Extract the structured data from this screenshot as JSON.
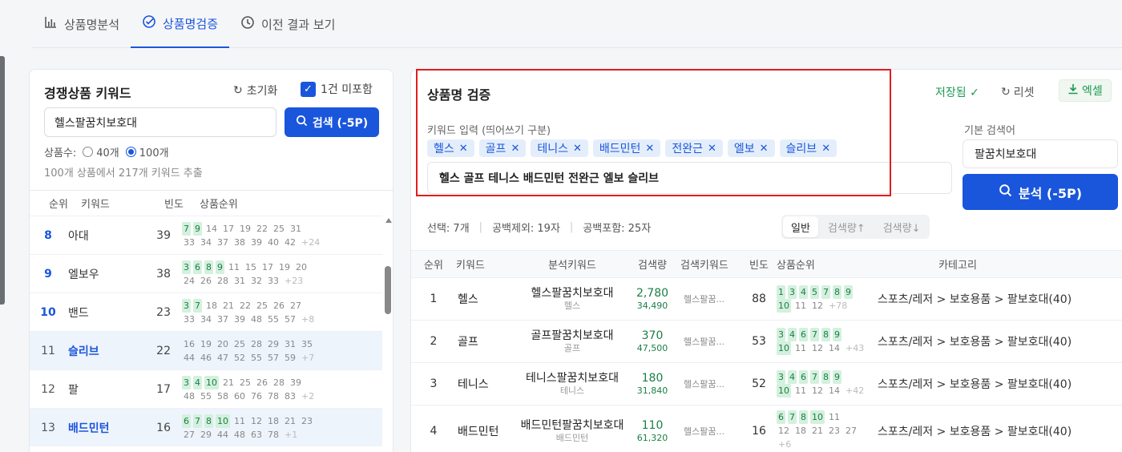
{
  "tabs": [
    {
      "label": "상품명분석",
      "icon": "bar-chart-icon"
    },
    {
      "label": "상품명검증",
      "icon": "check-circle-icon"
    },
    {
      "label": "이전 결과 보기",
      "icon": "clock-icon"
    }
  ],
  "left": {
    "title": "경쟁상품 키워드",
    "reset": "초기화",
    "check_label": "1건 미포함",
    "check_on": true,
    "input_value": "헬스팔꿈치보호대",
    "search_button": "검색 (-5P)",
    "count_label": "상품수:",
    "count_options": [
      "40개",
      "100개"
    ],
    "count_selected": "100개",
    "extract_text": "100개 상품에서 217개 키워드 추출",
    "headers": {
      "rank": "순위",
      "keyword": "키워드",
      "freq": "빈도",
      "ranks": "상품순위"
    },
    "rows": [
      {
        "rank": "8",
        "keyword": "아대",
        "freq": "39",
        "highlight": false,
        "blue": false,
        "rank_blue": true,
        "line1": [
          [
            "7",
            "g"
          ],
          [
            "9",
            "g"
          ],
          [
            "14",
            ""
          ],
          [
            "17",
            ""
          ],
          [
            "19",
            ""
          ],
          [
            "22",
            ""
          ],
          [
            "25",
            ""
          ],
          [
            "31",
            ""
          ]
        ],
        "line2": [
          [
            "33",
            ""
          ],
          [
            "34",
            ""
          ],
          [
            "37",
            ""
          ],
          [
            "38",
            ""
          ],
          [
            "39",
            ""
          ],
          [
            "40",
            ""
          ],
          [
            "42",
            ""
          ],
          [
            "+24",
            "more"
          ]
        ]
      },
      {
        "rank": "9",
        "keyword": "엘보우",
        "freq": "38",
        "highlight": false,
        "blue": false,
        "rank_blue": true,
        "line1": [
          [
            "3",
            "g"
          ],
          [
            "6",
            "g"
          ],
          [
            "8",
            "g"
          ],
          [
            "9",
            "g"
          ],
          [
            "11",
            ""
          ],
          [
            "15",
            ""
          ],
          [
            "17",
            ""
          ],
          [
            "19",
            ""
          ],
          [
            "20",
            ""
          ]
        ],
        "line2": [
          [
            "24",
            ""
          ],
          [
            "26",
            ""
          ],
          [
            "28",
            ""
          ],
          [
            "31",
            ""
          ],
          [
            "32",
            ""
          ],
          [
            "33",
            ""
          ],
          [
            "+23",
            "more"
          ]
        ]
      },
      {
        "rank": "10",
        "keyword": "밴드",
        "freq": "23",
        "highlight": false,
        "blue": false,
        "rank_blue": true,
        "line1": [
          [
            "3",
            "g"
          ],
          [
            "7",
            "g"
          ],
          [
            "18",
            ""
          ],
          [
            "21",
            ""
          ],
          [
            "22",
            ""
          ],
          [
            "25",
            ""
          ],
          [
            "26",
            ""
          ],
          [
            "27",
            ""
          ]
        ],
        "line2": [
          [
            "33",
            ""
          ],
          [
            "34",
            ""
          ],
          [
            "37",
            ""
          ],
          [
            "39",
            ""
          ],
          [
            "48",
            ""
          ],
          [
            "55",
            ""
          ],
          [
            "57",
            ""
          ],
          [
            "+8",
            "more"
          ]
        ]
      },
      {
        "rank": "11",
        "keyword": "슬리브",
        "freq": "22",
        "highlight": true,
        "blue": true,
        "rank_blue": false,
        "line1": [
          [
            "16",
            ""
          ],
          [
            "19",
            ""
          ],
          [
            "20",
            ""
          ],
          [
            "25",
            ""
          ],
          [
            "28",
            ""
          ],
          [
            "29",
            ""
          ],
          [
            "31",
            ""
          ],
          [
            "35",
            ""
          ]
        ],
        "line2": [
          [
            "44",
            ""
          ],
          [
            "46",
            ""
          ],
          [
            "47",
            ""
          ],
          [
            "52",
            ""
          ],
          [
            "55",
            ""
          ],
          [
            "57",
            ""
          ],
          [
            "59",
            ""
          ],
          [
            "+7",
            "more"
          ]
        ]
      },
      {
        "rank": "12",
        "keyword": "팔",
        "freq": "17",
        "highlight": false,
        "blue": false,
        "rank_blue": false,
        "line1": [
          [
            "3",
            "g"
          ],
          [
            "4",
            "g"
          ],
          [
            "10",
            "g"
          ],
          [
            "21",
            ""
          ],
          [
            "25",
            ""
          ],
          [
            "26",
            ""
          ],
          [
            "28",
            ""
          ],
          [
            "39",
            ""
          ]
        ],
        "line2": [
          [
            "48",
            ""
          ],
          [
            "55",
            ""
          ],
          [
            "58",
            ""
          ],
          [
            "60",
            ""
          ],
          [
            "76",
            ""
          ],
          [
            "78",
            ""
          ],
          [
            "83",
            ""
          ],
          [
            "+2",
            "more"
          ]
        ]
      },
      {
        "rank": "13",
        "keyword": "배드민턴",
        "freq": "16",
        "highlight": true,
        "blue": true,
        "rank_blue": false,
        "line1": [
          [
            "6",
            "g"
          ],
          [
            "7",
            "g"
          ],
          [
            "8",
            "g"
          ],
          [
            "10",
            "g"
          ],
          [
            "11",
            ""
          ],
          [
            "12",
            ""
          ],
          [
            "18",
            ""
          ],
          [
            "21",
            ""
          ],
          [
            "23",
            ""
          ]
        ],
        "line2": [
          [
            "27",
            ""
          ],
          [
            "29",
            ""
          ],
          [
            "44",
            ""
          ],
          [
            "48",
            ""
          ],
          [
            "63",
            ""
          ],
          [
            "78",
            ""
          ],
          [
            "+1",
            "more"
          ]
        ]
      }
    ]
  },
  "right": {
    "title": "상품명 검증",
    "saved": "저장됨 ✓",
    "reset": "리셋",
    "excel": "엑셀",
    "kw_label": "키워드 입력 (띄어쓰기 구분)",
    "tags": [
      "헬스",
      "골프",
      "테니스",
      "배드민턴",
      "전완근",
      "엘보",
      "슬리브"
    ],
    "textbox": "헬스 골프 테니스 배드민턴 전완근 엘보 슬리브",
    "base_label": "기본 검색어",
    "base_value": "팔꿈치보호대",
    "analyze_button": "분석 (-5P)",
    "stats": [
      "선택: 7개",
      "공백제외: 19자",
      "공백포함: 25자"
    ],
    "sort": [
      "일반",
      "검색량↑",
      "검색량↓"
    ],
    "sort_selected": "일반",
    "headers": {
      "rank": "순위",
      "keyword": "키워드",
      "analysis": "분석키워드",
      "volume": "검색량",
      "search_kw": "검색키워드",
      "freq": "빈도",
      "ranks": "상품순위",
      "category": "카테고리"
    },
    "rows": [
      {
        "rank": "1",
        "keyword": "헬스",
        "analysis": "헬스팔꿈치보호대",
        "analysis_sub": "헬스",
        "vol": "2,780",
        "vol_sub": "34,490",
        "search_kw": "헬스팔꿈...",
        "freq": "88",
        "line1": [
          [
            "1",
            "g"
          ],
          [
            "3",
            "g"
          ],
          [
            "4",
            "g"
          ],
          [
            "5",
            "g"
          ],
          [
            "7",
            "g"
          ],
          [
            "8",
            "g"
          ],
          [
            "9",
            "g"
          ]
        ],
        "line2": [
          [
            "10",
            "g"
          ],
          [
            "11",
            ""
          ],
          [
            "12",
            ""
          ],
          [
            "+78",
            "more"
          ]
        ],
        "category": "스포츠/레저 > 보호용품 > 팔보호대(40)"
      },
      {
        "rank": "2",
        "keyword": "골프",
        "analysis": "골프팔꿈치보호대",
        "analysis_sub": "골프",
        "vol": "370",
        "vol_sub": "47,500",
        "search_kw": "헬스팔꿈...",
        "freq": "53",
        "line1": [
          [
            "3",
            "g"
          ],
          [
            "4",
            "g"
          ],
          [
            "6",
            "g"
          ],
          [
            "7",
            "g"
          ],
          [
            "8",
            "g"
          ],
          [
            "9",
            "g"
          ]
        ],
        "line2": [
          [
            "10",
            "g"
          ],
          [
            "11",
            ""
          ],
          [
            "12",
            ""
          ],
          [
            "14",
            ""
          ],
          [
            "+43",
            "more"
          ]
        ],
        "category": "스포츠/레저 > 보호용품 > 팔보호대(40)"
      },
      {
        "rank": "3",
        "keyword": "테니스",
        "analysis": "테니스팔꿈치보호대",
        "analysis_sub": "테니스",
        "vol": "180",
        "vol_sub": "31,840",
        "search_kw": "헬스팔꿈...",
        "freq": "52",
        "line1": [
          [
            "3",
            "g"
          ],
          [
            "4",
            "g"
          ],
          [
            "6",
            "g"
          ],
          [
            "7",
            "g"
          ],
          [
            "8",
            "g"
          ],
          [
            "9",
            "g"
          ]
        ],
        "line2": [
          [
            "10",
            "g"
          ],
          [
            "11",
            ""
          ],
          [
            "12",
            ""
          ],
          [
            "14",
            ""
          ],
          [
            "+42",
            "more"
          ]
        ],
        "category": "스포츠/레저 > 보호용품 > 팔보호대(40)"
      },
      {
        "rank": "4",
        "keyword": "배드민턴",
        "analysis": "배드민턴팔꿈치보호대",
        "analysis_sub": "배드민턴",
        "vol": "110",
        "vol_sub": "61,320",
        "search_kw": "헬스팔꿈...",
        "freq": "16",
        "line1": [
          [
            "6",
            "g"
          ],
          [
            "7",
            "g"
          ],
          [
            "8",
            "g"
          ],
          [
            "10",
            "g"
          ],
          [
            "11",
            ""
          ]
        ],
        "line2": [
          [
            "12",
            ""
          ],
          [
            "18",
            ""
          ],
          [
            "21",
            ""
          ],
          [
            "23",
            ""
          ],
          [
            "27",
            ""
          ]
        ],
        "line3": [
          [
            "+6",
            "more"
          ]
        ],
        "category": "스포츠/레저 > 보호용품 > 팔보호대(40)"
      }
    ]
  }
}
